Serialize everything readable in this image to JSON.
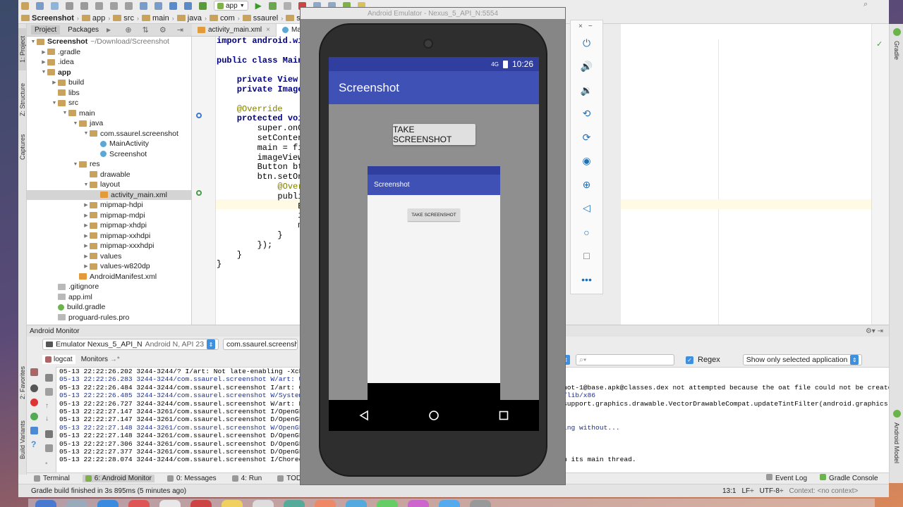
{
  "toolbar": {
    "run_config": "app",
    "breadcrumbs": [
      "Screenshot",
      "app",
      "src",
      "main",
      "java",
      "com",
      "ssaurel",
      "screenshot"
    ]
  },
  "project_panel": {
    "tabs": [
      "Project",
      "Packages"
    ],
    "tree": [
      {
        "label": "Screenshot",
        "suffix": "~/Download/Screenshot",
        "icon": "fold",
        "depth": 0,
        "open": true,
        "bold": true
      },
      {
        "label": ".gradle",
        "icon": "fold",
        "depth": 1,
        "open": false
      },
      {
        "label": ".idea",
        "icon": "fold",
        "depth": 1,
        "open": false
      },
      {
        "label": "app",
        "icon": "fold",
        "depth": 1,
        "open": true,
        "bold": true
      },
      {
        "label": "build",
        "icon": "fold",
        "depth": 2,
        "open": false
      },
      {
        "label": "libs",
        "icon": "fold",
        "depth": 2,
        "open": null
      },
      {
        "label": "src",
        "icon": "fold",
        "depth": 2,
        "open": true
      },
      {
        "label": "main",
        "icon": "fold",
        "depth": 3,
        "open": true
      },
      {
        "label": "java",
        "icon": "fold",
        "depth": 4,
        "open": true
      },
      {
        "label": "com.ssaurel.screenshot",
        "icon": "fold",
        "depth": 5,
        "open": true
      },
      {
        "label": "MainActivity",
        "icon": "java",
        "depth": 6,
        "open": null
      },
      {
        "label": "Screenshot",
        "icon": "java",
        "depth": 6,
        "open": null
      },
      {
        "label": "res",
        "icon": "fold",
        "depth": 4,
        "open": true
      },
      {
        "label": "drawable",
        "icon": "fold",
        "depth": 5,
        "open": null
      },
      {
        "label": "layout",
        "icon": "fold",
        "depth": 5,
        "open": true
      },
      {
        "label": "activity_main.xml",
        "icon": "xml",
        "depth": 6,
        "open": null,
        "selected": true
      },
      {
        "label": "mipmap-hdpi",
        "icon": "fold",
        "depth": 5,
        "open": false
      },
      {
        "label": "mipmap-mdpi",
        "icon": "fold",
        "depth": 5,
        "open": false
      },
      {
        "label": "mipmap-xhdpi",
        "icon": "fold",
        "depth": 5,
        "open": false
      },
      {
        "label": "mipmap-xxhdpi",
        "icon": "fold",
        "depth": 5,
        "open": false
      },
      {
        "label": "mipmap-xxxhdpi",
        "icon": "fold",
        "depth": 5,
        "open": false
      },
      {
        "label": "values",
        "icon": "fold",
        "depth": 5,
        "open": false
      },
      {
        "label": "values-w820dp",
        "icon": "fold",
        "depth": 5,
        "open": false
      },
      {
        "label": "AndroidManifest.xml",
        "icon": "xml",
        "depth": 4,
        "open": null
      },
      {
        "label": ".gitignore",
        "icon": "file",
        "depth": 2,
        "open": null
      },
      {
        "label": "app.iml",
        "icon": "file",
        "depth": 2,
        "open": null
      },
      {
        "label": "build.gradle",
        "icon": "grad",
        "depth": 2,
        "open": null
      },
      {
        "label": "proguard-rules.pro",
        "icon": "file",
        "depth": 2,
        "open": null
      }
    ]
  },
  "editor": {
    "tabs": [
      "activity_main.xml",
      "MainA"
    ],
    "code_lines": [
      "import android.wic",
      "",
      "public class MainA",
      "",
      "    private View m",
      "    private ImageV",
      "",
      "    @Override",
      "    protected voi",
      "        super.onC",
      "        setConten",
      "        main = fi",
      "        imageView",
      "        Button bt",
      "        btn.setOn",
      "            @Over",
      "            publi",
      "                B",
      "                i",
      "                m",
      "            }",
      "        });",
      "    }",
      "}"
    ]
  },
  "vertical_tabs": {
    "left": [
      "1: Project",
      "Z: Structure",
      "Captures",
      "2: Favorites",
      "Build Variants"
    ],
    "right": [
      "Gradle",
      "Android Model"
    ]
  },
  "monitor": {
    "title": "Android Monitor",
    "device": "Emulator Nexus_5_API_N",
    "device_suffix": "Android N, API 23",
    "process": "com.ssaurel.screenshot",
    "tabs": [
      "logcat",
      "Monitors"
    ],
    "regex_label": "Regex",
    "filter_option": "Show only selected application",
    "logs": [
      {
        "text": "05-13 22:22:26.202 3244-3244/? I/art: Not late-enabling -Xcheck",
        "level": "info"
      },
      {
        "text": "05-13 22:22:26.283 3244-3244/com.ssaurel.screenshot W/art: Unex",
        "level": "verbose"
      },
      {
        "text": "05-13 22:22:26.484 3244-3244/com.ssaurel.screenshot I/art: Gene",
        "level": "info"
      },
      {
        "text": "05-13 22:22:26.485 3244-3244/com.ssaurel.screenshot W/System: C",
        "level": "verbose"
      },
      {
        "text": "05-13 22:22:26.727 3244-3244/com.ssaurel.screenshot W/art: Befo",
        "level": "info"
      },
      {
        "text": "05-13 22:22:27.147 3244-3261/com.ssaurel.screenshot I/OpenGLRen",
        "level": "info"
      },
      {
        "text": "05-13 22:22:27.147 3244-3261/com.ssaurel.screenshot D/OpenGLRen",
        "level": "info"
      },
      {
        "text": "05-13 22:22:27.148 3244-3261/com.ssaurel.screenshot W/OpenGLRen",
        "level": "verbose"
      },
      {
        "text": "05-13 22:22:27.148 3244-3261/com.ssaurel.screenshot D/OpenGLRen",
        "level": "info"
      },
      {
        "text": "05-13 22:22:27.306 3244-3261/com.ssaurel.screenshot D/OpenGLRen",
        "level": "info"
      },
      {
        "text": "05-13 22:22:27.377 3244-3261/com.ssaurel.screenshot D/OpenGLRen",
        "level": "info"
      },
      {
        "text": "05-13 22:22:28.074 3244-3244/com.ssaurel.screenshot I/Choreogra",
        "level": "info"
      }
    ],
    "log_tails": [
      {
        "text": "hot-1@base.apk@classes.dex not attempted because the oat file could not be created.",
        "row": 2
      },
      {
        "text": "/lib/x86",
        "row": 3
      },
      {
        "text": "support.graphics.drawable.VectorDrawableCompat.updateTintFilter(android.graphics.Po",
        "row": 4
      },
      {
        "text": "ing without...",
        "row": 7
      },
      {
        "text": "n its main thread.",
        "row": 11
      }
    ]
  },
  "bottom_tools": [
    {
      "label": "Terminal",
      "icon": "terminal-icon"
    },
    {
      "label": "6: Android Monitor",
      "icon": "android-icon",
      "active": true
    },
    {
      "label": "0: Messages",
      "icon": "messages-icon"
    },
    {
      "label": "4: Run",
      "icon": "run-icon"
    },
    {
      "label": "TODO",
      "icon": "todo-icon"
    }
  ],
  "bottom_right_tools": [
    "Event Log",
    "Gradle Console"
  ],
  "status": {
    "message": "Gradle build finished in 3s 895ms (5 minutes ago)",
    "position": "13:1",
    "line_sep": "LF÷",
    "encoding": "UTF-8÷",
    "context": "Context: <no context>"
  },
  "emulator": {
    "title": "Android Emulator - Nexus_5_API_N:5554",
    "time": "10:26",
    "network": "4G",
    "app_title": "Screenshot",
    "button_label": "TAKE SCREENSHOT",
    "preview_title": "Screenshot",
    "preview_button": "TAKE SCREENSHOT",
    "tools": [
      "power-icon",
      "volume-up-icon",
      "volume-down-icon",
      "rotate-left-icon",
      "rotate-right-icon",
      "camera-icon",
      "zoom-icon",
      "back-icon",
      "home-icon",
      "overview-icon",
      "more-icon"
    ]
  },
  "colors": {
    "primary": "#3f51b5",
    "primary_dark": "#303f9f",
    "accent_blue": "#3d8fe0"
  }
}
